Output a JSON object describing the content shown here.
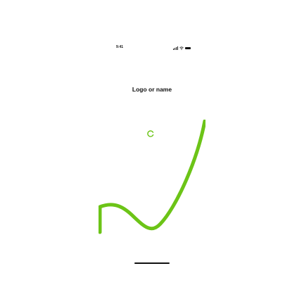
{
  "status_bar": {
    "time": "9:41",
    "icons": [
      "signal-icon",
      "wifi-icon",
      "battery-icon"
    ]
  },
  "logo": {
    "text": "Logo or name"
  },
  "loader": {
    "icon": "loading-spinner-icon"
  },
  "colors": {
    "accent": "#6cc417",
    "text": "#111111",
    "background": "#ffffff"
  }
}
